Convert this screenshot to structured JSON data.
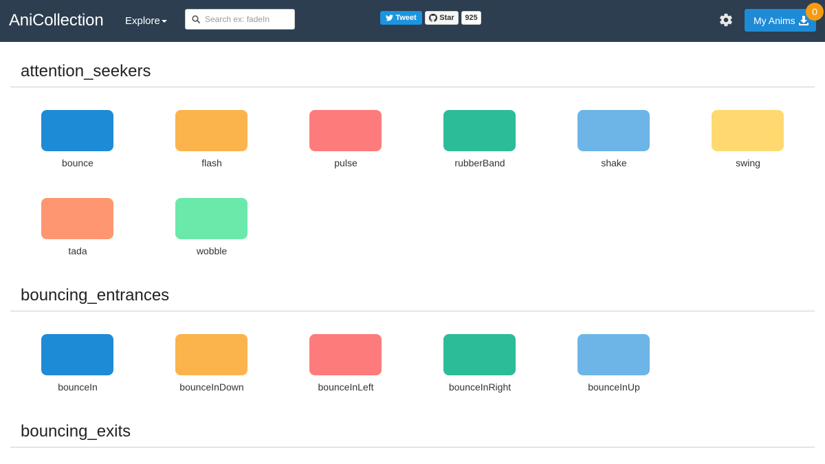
{
  "app": {
    "brand": "AniCollection",
    "explore_label": "Explore"
  },
  "search": {
    "placeholder": "Search ex: fadeIn",
    "value": ""
  },
  "social": {
    "tweet_label": "Tweet",
    "star_label": "Star",
    "star_count": "925"
  },
  "my_anims": {
    "label": "My Anims",
    "count": "0"
  },
  "icons": [
    "search-icon",
    "twitter-icon",
    "github-icon",
    "gear-icon",
    "download-icon",
    "caret-down-icon"
  ],
  "colors": {
    "navbar": "#2c3e50",
    "primary": "#1e8bd6",
    "badge": "#f39c12",
    "blue": "#1e8bd6",
    "orange": "#fbb44c",
    "red": "#fd7b7b",
    "teal": "#2cbc98",
    "lightblue": "#6db5e6",
    "yellow": "#ffd970",
    "salmon": "#fe9671",
    "mint": "#6ae9ab"
  },
  "sections": [
    {
      "title": "attention_seekers",
      "items": [
        {
          "label": "bounce",
          "color": "#1e8bd6"
        },
        {
          "label": "flash",
          "color": "#fbb44c"
        },
        {
          "label": "pulse",
          "color": "#fd7b7b"
        },
        {
          "label": "rubberBand",
          "color": "#2cbc98"
        },
        {
          "label": "shake",
          "color": "#6db5e6"
        },
        {
          "label": "swing",
          "color": "#ffd970"
        },
        {
          "label": "tada",
          "color": "#fe9671"
        },
        {
          "label": "wobble",
          "color": "#6ae9ab"
        }
      ]
    },
    {
      "title": "bouncing_entrances",
      "items": [
        {
          "label": "bounceIn",
          "color": "#1e8bd6"
        },
        {
          "label": "bounceInDown",
          "color": "#fbb44c"
        },
        {
          "label": "bounceInLeft",
          "color": "#fd7b7b"
        },
        {
          "label": "bounceInRight",
          "color": "#2cbc98"
        },
        {
          "label": "bounceInUp",
          "color": "#6db5e6"
        }
      ]
    },
    {
      "title": "bouncing_exits",
      "items": []
    }
  ]
}
